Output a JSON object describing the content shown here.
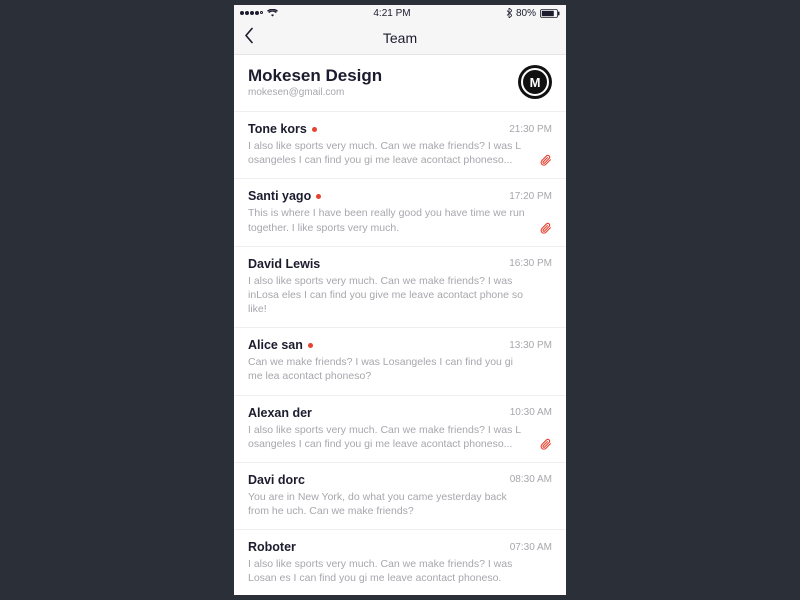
{
  "statusBar": {
    "time": "4:21 PM",
    "battery": "80%"
  },
  "nav": {
    "title": "Team"
  },
  "header": {
    "title": "Mokesen Design",
    "subtitle": "mokesen@gmail.com",
    "logoLetter": "M"
  },
  "messages": [
    {
      "name": "Tone kors",
      "unread": true,
      "time": "21:30 PM",
      "preview": "I also like sports very much. Can we make friends? I was L osangeles I can find you gi me leave acontact phoneso...",
      "attachment": true
    },
    {
      "name": "Santi yago",
      "unread": true,
      "time": "17:20 PM",
      "preview": "This is where I have been really good you have time we run together. I like sports very much.",
      "attachment": true
    },
    {
      "name": "David Lewis",
      "unread": false,
      "time": "16:30 PM",
      "preview": "I also like sports very much. Can we make friends? I was inLosa eles I can find you give me leave acontact phone so like!",
      "attachment": false
    },
    {
      "name": "Alice san",
      "unread": true,
      "time": "13:30 PM",
      "preview": "Can we make friends? I was Losangeles I can find you gi me lea acontact phoneso?",
      "attachment": false
    },
    {
      "name": "Alexan der",
      "unread": false,
      "time": "10:30 AM",
      "preview": "I also like sports very much. Can we make friends? I was L osangeles I can find you gi me leave acontact phoneso...",
      "attachment": true
    },
    {
      "name": "Davi dorc",
      "unread": false,
      "time": "08:30 AM",
      "preview": "You are in New York, do what you came yesterday back from he uch. Can we make friends?",
      "attachment": false
    },
    {
      "name": "Roboter",
      "unread": false,
      "time": "07:30 AM",
      "preview": "I also like sports very much. Can we make friends? I was Losan es I can find you gi me leave acontact phoneso.",
      "attachment": false
    }
  ]
}
